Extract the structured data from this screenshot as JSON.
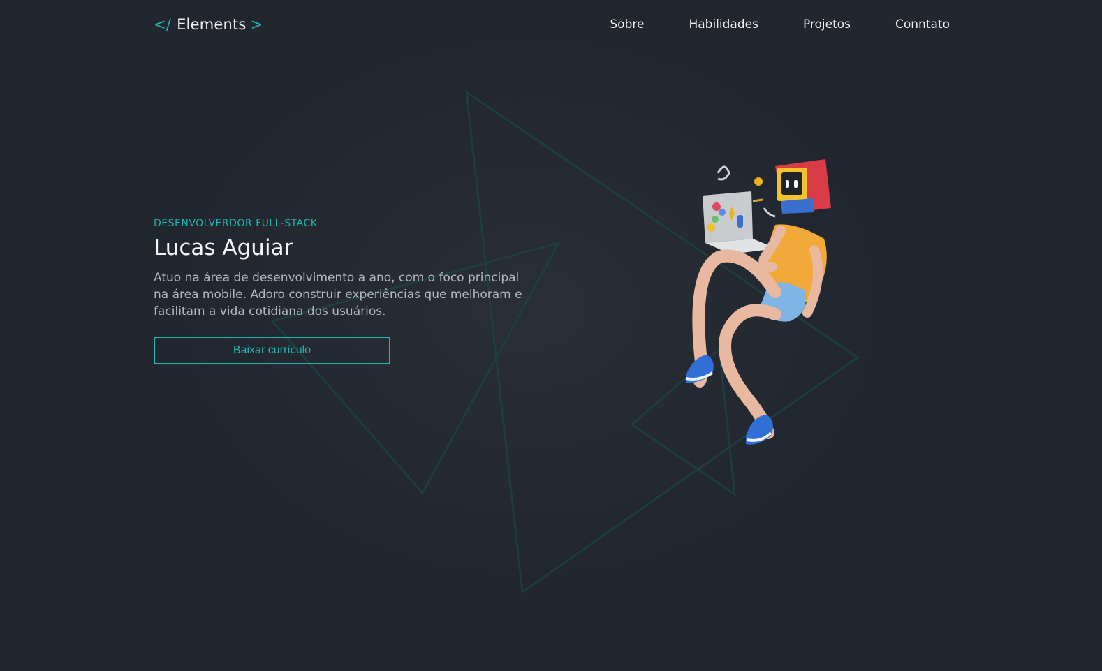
{
  "header": {
    "logo": {
      "open": "</",
      "name": "Elements",
      "close": ">"
    },
    "nav": [
      {
        "label": "Sobre"
      },
      {
        "label": "Habilidades"
      },
      {
        "label": "Projetos"
      },
      {
        "label": "Conntato"
      }
    ]
  },
  "hero": {
    "subtitle": "DESENVOLVERDOR FULL-STACK",
    "title": "Lucas Aguiar",
    "description": "Atuo na área de desenvolvimento a ano, com o foco principal na área mobile. Adoro construir experiências que melhoram e facilitam a vida cotidiana dos usuários.",
    "cta_label": "Baixar currículo"
  },
  "colors": {
    "accent": "#1fb5b0",
    "background": "#21262f",
    "text": "#eef0f2",
    "muted_text": "#b4b8bf"
  },
  "icons": [
    "code-bracket-icon",
    "triangle-outline-icon",
    "developer-3d-illustration"
  ]
}
